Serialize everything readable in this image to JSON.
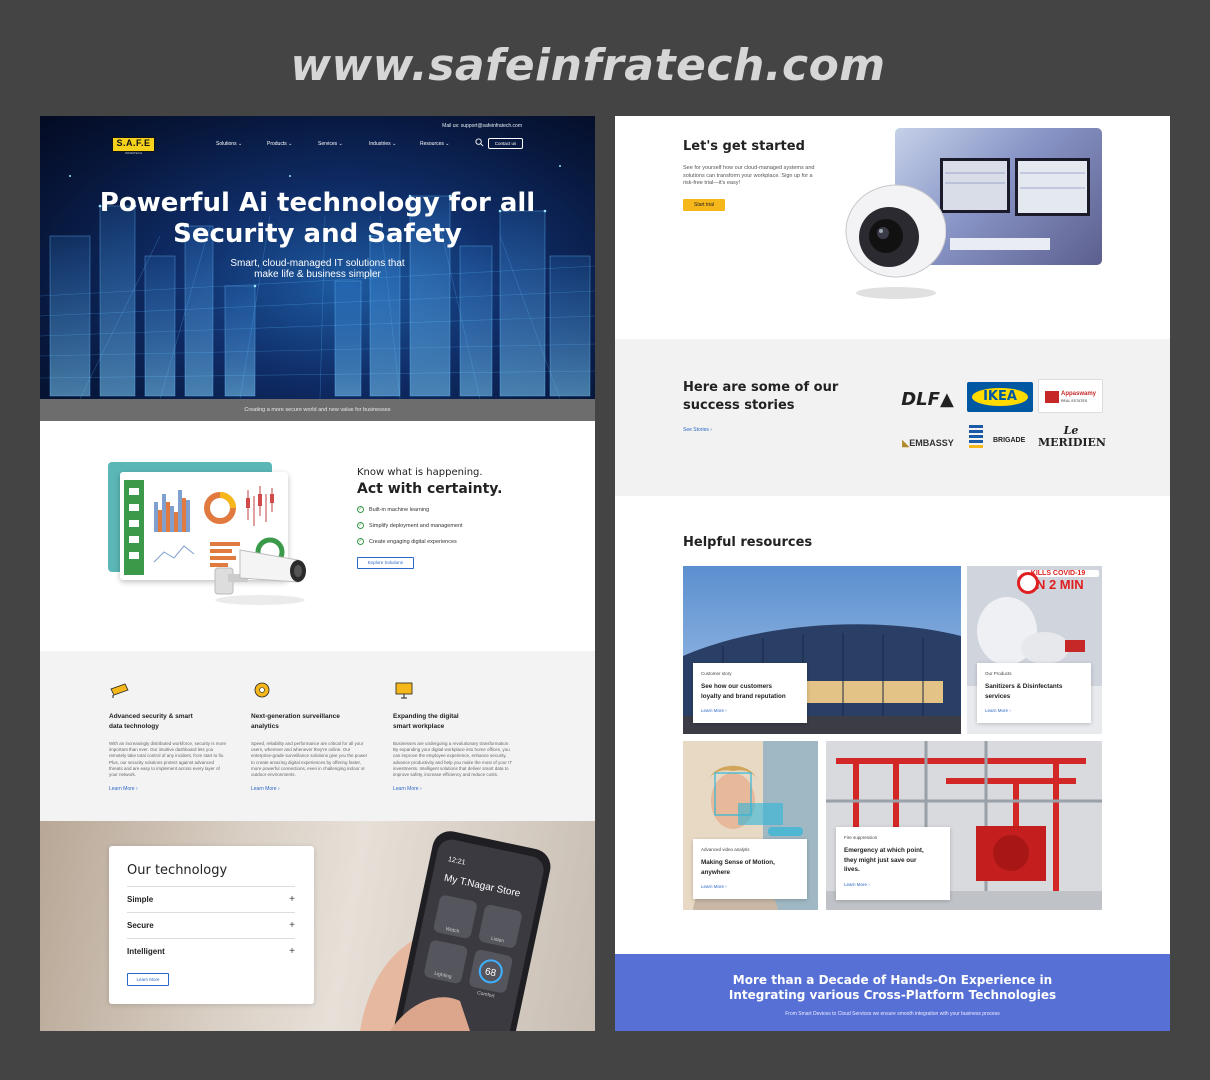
{
  "watermark": {
    "url": "www.safeinfratech.com"
  },
  "header": {
    "mail": "Mail us: support@safeinfratech.com",
    "logo_text": "S.A.F.E",
    "logo_sub": "INFRATECH",
    "nav": [
      "Solutions",
      "Products",
      "Services",
      "Industries",
      "Resources"
    ],
    "contact_label": "Contact us"
  },
  "hero": {
    "title_line1": "Powerful Ai technology for all",
    "title_line2": "Security and Safety",
    "subtitle_line1": "Smart, cloud-managed IT solutions that",
    "subtitle_line2": "make life & business simpler",
    "strip": "Creating a more secure world and new value for businesses"
  },
  "know": {
    "heading_line1": "Know what is happening.",
    "heading_line2": "Act with certainty.",
    "features": [
      "Built-in machine learning",
      "Simplify deployment and management",
      "Create engaging digital experiences"
    ],
    "button": "Explore Solutions"
  },
  "features": [
    {
      "title_line1": "Advanced security & smart",
      "title_line2": "data technology",
      "body": "With an increasingly distributed workforce, security is more important than ever. Our intuitive dashboard lets you remotely take total control of any incident, from start to fix. Plus, our security solutions protect against advanced threats and are easy to implement across every layer of your network.",
      "more": "Learn More"
    },
    {
      "title_line1": "Next-generation surveillance",
      "title_line2": "analytics",
      "body": "Speed, reliability and performance are critical for all your users, wherever and whenever they're online. Our enterprise-grade surveillance solutions give you the power to create amazing digital experiences by offering faster, more powerful connections, even in challenging indoor or outdoor environments.",
      "more": "Learn More"
    },
    {
      "title_line1": "Expanding the digital",
      "title_line2": "smart workplace",
      "body": "Businesses are undergoing a revolutionary transformation. By expanding your digital workplace into home offices, you can improve the employee experience, enhance security, advance productivity and help you make the most of your IT investments. Intelligent solutions that deliver smart data to improve safety, increase efficiency and reduce costs.",
      "more": "Learn More"
    }
  ],
  "technology": {
    "title": "Our technology",
    "items": [
      "Simple",
      "Secure",
      "Intelligent"
    ],
    "button": "Learn More",
    "phone_title": "My T.Nagar Store",
    "phone_time": "12:21",
    "phone_labels": [
      "Watch",
      "Listen",
      "Lighting",
      "Comfort"
    ],
    "phone_temp": "68"
  },
  "start": {
    "title": "Let's get started",
    "body": "See for yourself how our cloud-managed systems and solutions can transform your workplace. Sign up for a risk-free trial—it's easy!",
    "button": "Start trial"
  },
  "success": {
    "title_line1": "Here are some of our",
    "title_line2": "success stories",
    "link": "See Stories",
    "clients": [
      "DLF",
      "IKEA",
      "Appaswamy",
      "REAL ESTATES",
      "EMBASSY",
      "BRIGADE",
      "Le",
      "MERIDIEN"
    ]
  },
  "resources": {
    "title": "Helpful resources",
    "tiles": [
      {
        "category": "Customer story",
        "title_line1": "See how our customers",
        "title_line2": "loyalty and brand reputation",
        "more": "Learn More"
      },
      {
        "category": "Our Products",
        "title_line1": "Sanitizers & Disinfectants",
        "title_line2": "services",
        "more": "Learn More",
        "banner_line1": "KILLS COVID-19",
        "banner_line2": "IN 2 MIN"
      },
      {
        "category": "Advanced video analytis",
        "title_line1": "Making Sense of Motion,",
        "title_line2": "anywhere",
        "more": "Learn More"
      },
      {
        "category": "Fire suppression",
        "title_line1": "Emergency at which point,",
        "title_line2": "they might just save our",
        "title_line3": "lives.",
        "more": "Learn More"
      }
    ]
  },
  "decade": {
    "title_line1": "More than a Decade of Hands-On Experience in",
    "title_line2": "Integrating various Cross-Platform Technologies",
    "subtitle": "From Smart Devices to Cloud Services we ensure smooth integration with your business process"
  },
  "colors": {
    "accent_blue": "#2b67c6",
    "cta_yellow": "#f6b71a",
    "banner_blue": "#5670d6",
    "brand_yellow": "#f6d21c"
  }
}
